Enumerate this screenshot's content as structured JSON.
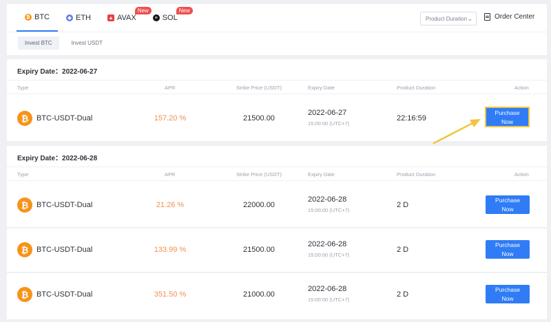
{
  "coin_tabs": [
    {
      "label": "BTC",
      "active": true,
      "new": false
    },
    {
      "label": "ETH",
      "active": false,
      "new": false
    },
    {
      "label": "AVAX",
      "active": false,
      "new": true
    },
    {
      "label": "SOL",
      "active": false,
      "new": true
    }
  ],
  "new_badge": "New",
  "product_duration_select": "Product Duration",
  "order_center": "Order Center",
  "invest_tabs": [
    "Invest BTC",
    "Invest USDT"
  ],
  "columns": {
    "type": "Type",
    "apr": "APR",
    "strike": "Strike Price (USDT)",
    "expiry": "Expiry Date",
    "duration": "Product Duration",
    "action": "Action"
  },
  "sections": [
    {
      "title": "Expiry Date：2022-06-27",
      "rows": [
        {
          "type": "BTC-USDT-Dual",
          "apr": "157.20 %",
          "strike": "21500.00",
          "date": "2022-06-27",
          "time": "15:00:00 (UTC+7)",
          "duration": "22:16:59",
          "btn_top": "Purchase",
          "btn_bottom": "Now"
        }
      ]
    },
    {
      "title": "Expiry Date：2022-06-28",
      "rows": [
        {
          "type": "BTC-USDT-Dual",
          "apr": "21.26 %",
          "strike": "22000.00",
          "date": "2022-06-28",
          "time": "15:00:00 (UTC+7)",
          "duration": "2 D",
          "btn_top": "Purchase",
          "btn_bottom": "Now"
        },
        {
          "type": "BTC-USDT-Dual",
          "apr": "133.99 %",
          "strike": "21500.00",
          "date": "2022-06-28",
          "time": "15:00:00 (UTC+7)",
          "duration": "2 D",
          "btn_top": "Purchase",
          "btn_bottom": "Now"
        },
        {
          "type": "BTC-USDT-Dual",
          "apr": "351.50 %",
          "strike": "21000.00",
          "date": "2022-06-28",
          "time": "15:00:00 (UTC+7)",
          "duration": "2 D",
          "btn_top": "Purchase",
          "btn_bottom": "Now"
        }
      ]
    }
  ],
  "colors": {
    "accent": "#2f7cf6",
    "apr": "#f0904a",
    "highlight": "#f0c53c",
    "btc": "#f7931a"
  }
}
